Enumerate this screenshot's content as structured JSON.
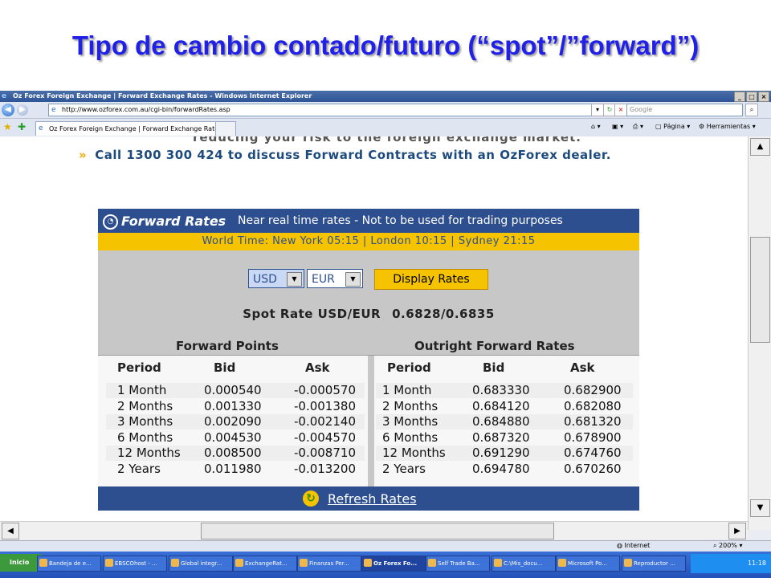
{
  "slide": {
    "title": "Tipo de cambio contado/futuro (“spot”/”forward”)"
  },
  "browser": {
    "window_title": "Oz Forex Foreign Exchange | Forward Exchange Rates - Windows Internet Explorer",
    "url": "http://www.ozforex.com.au/cgi-bin/forwardRates.asp",
    "search_placeholder": "Google",
    "tab_title": "Oz Forex Foreign Exchange | Forward Exchange Rates",
    "toolbar": {
      "page_label": "Página",
      "tools_label": "Herramientas"
    },
    "status": {
      "zone": "Internet",
      "zoom": "200%"
    }
  },
  "page": {
    "cutoff_text": "reducing your risk to the foreign exchange market.",
    "call_text": "Call 1300 300 424 to discuss Forward Contracts with an OzForex dealer."
  },
  "widget": {
    "logo": "Forward Rates",
    "subtitle": "Near real time rates - Not to be used for trading purposes",
    "world_time": "World Time: New York 05:15  |  London 10:15  |  Sydney 21:15",
    "from_currency": "USD",
    "to_currency": "EUR",
    "display_button": "Display Rates",
    "spot_label": "Spot Rate USD/EUR",
    "spot_value": "0.6828/0.6835",
    "forward_points_title": "Forward Points",
    "outright_title": "Outright Forward Rates",
    "columns": [
      "Period",
      "Bid",
      "Ask"
    ],
    "forward_points": [
      {
        "period": "1 Month",
        "bid": "0.000540",
        "ask": "-0.000570"
      },
      {
        "period": "2 Months",
        "bid": "0.001330",
        "ask": "-0.001380"
      },
      {
        "period": "3 Months",
        "bid": "0.002090",
        "ask": "-0.002140"
      },
      {
        "period": "6 Months",
        "bid": "0.004530",
        "ask": "-0.004570"
      },
      {
        "period": "12 Months",
        "bid": "0.008500",
        "ask": "-0.008710"
      },
      {
        "period": "2 Years",
        "bid": "0.011980",
        "ask": "-0.013200"
      }
    ],
    "outright": [
      {
        "period": "1 Month",
        "bid": "0.683330",
        "ask": "0.682900"
      },
      {
        "period": "2 Months",
        "bid": "0.684120",
        "ask": "0.682080"
      },
      {
        "period": "3 Months",
        "bid": "0.684880",
        "ask": "0.681320"
      },
      {
        "period": "6 Months",
        "bid": "0.687320",
        "ask": "0.678900"
      },
      {
        "period": "12 Months",
        "bid": "0.691290",
        "ask": "0.674760"
      },
      {
        "period": "2 Years",
        "bid": "0.694780",
        "ask": "0.670260"
      }
    ],
    "refresh": "Refresh Rates"
  },
  "taskbar": {
    "start": "Inicio",
    "items": [
      "Bandeja de e...",
      "EBSCOhost - ...",
      "Global integr...",
      "ExchangeRat...",
      "Finanzas Per...",
      "Oz Forex Fo...",
      "Self Trade Ba...",
      "C:\\Mis_docu...",
      "Microsoft Po...",
      "Reproductor ..."
    ],
    "clock": "11:18"
  },
  "colors": {
    "title": "#2020e8",
    "widget_header": "#2d4f8f",
    "widget_accent": "#f5c300"
  }
}
